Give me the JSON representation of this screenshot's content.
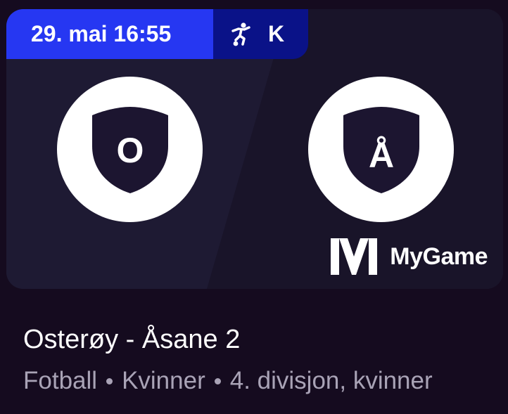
{
  "event": {
    "datetime": "29. mai 16:55",
    "category_letter": "K",
    "category_icon": "football-player-icon",
    "home_initial": "O",
    "away_initial": "Å",
    "title": "Osterøy - Åsane 2",
    "sport": "Fotball",
    "gender": "Kvinner",
    "league": "4. divisjon, kvinner"
  },
  "brand": {
    "name": "MyGame",
    "logo_letter": "M"
  },
  "colors": {
    "page_bg": "#150b1f",
    "card_bg": "#1e1a33",
    "date_badge": "#2637f2",
    "category_badge": "#0a1288",
    "shield": "#1c1530",
    "muted_text": "#a9a3b6"
  }
}
